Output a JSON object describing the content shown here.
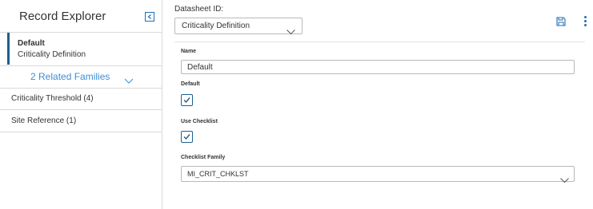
{
  "sidebar": {
    "title": "Record Explorer",
    "record": {
      "title": "Default",
      "subtitle": "Criticality Definition"
    },
    "related_families_label": "2 Related Families",
    "related_items": [
      {
        "label": "Criticality Threshold (4)"
      },
      {
        "label": "Site Reference (1)"
      }
    ]
  },
  "header": {
    "datasheet_label": "Datasheet ID:",
    "datasheet_value": "Criticality Definition"
  },
  "form": {
    "name_label": "Name",
    "name_value": "Default",
    "default_label": "Default",
    "default_checked": true,
    "use_checklist_label": "Use Checklist",
    "use_checklist_checked": true,
    "checklist_family_label": "Checklist Family",
    "checklist_family_value": "MI_CRIT_CHKLST"
  },
  "icons": {
    "collapse": "collapse-left-icon",
    "chevron": "chevron-down-icon",
    "save": "save-icon",
    "more": "more-vertical-icon",
    "check": "check-icon"
  },
  "colors": {
    "accent": "#1f6fb5",
    "selected_bar": "#1e5f8f",
    "link": "#3b8fd6",
    "border": "#d9d9d9"
  }
}
